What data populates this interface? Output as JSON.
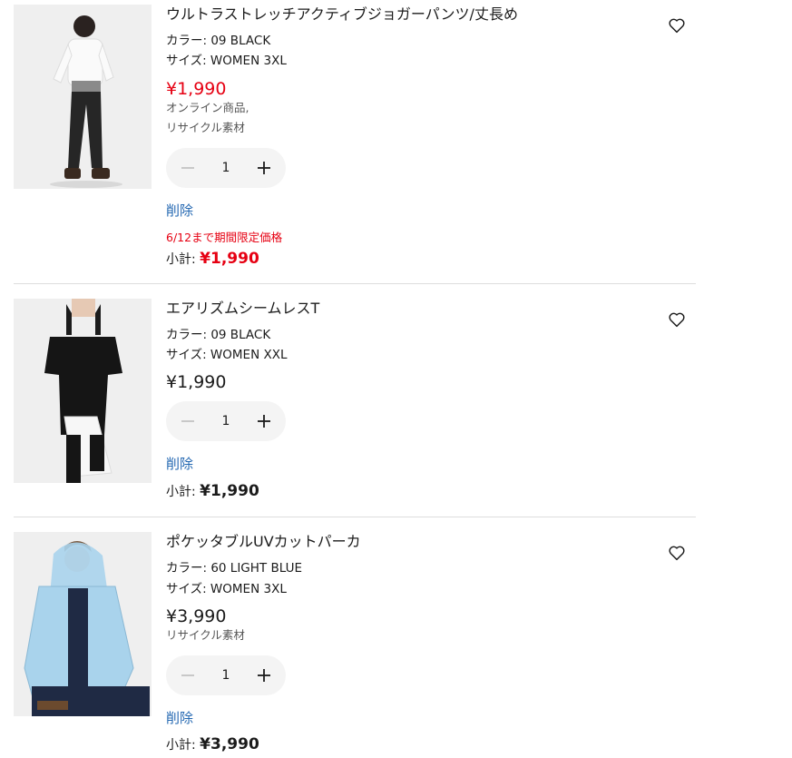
{
  "items": [
    {
      "name": "ウルトラストレッチアクティブジョガーパンツ/丈長め",
      "color_label": "カラー: 09 BLACK",
      "size_label": "サイズ: WOMEN 3XL",
      "price": "¥1,990",
      "price_color": "#e60012",
      "notes": [
        "オンライン商品,",
        "リサイクル素材"
      ],
      "quantity": "1",
      "delete_label": "削除",
      "promo": "6/12まで期間限定価格",
      "subtotal_label": "小計:",
      "subtotal_value": "¥1,990",
      "favorite_icon": "heart-outline-icon"
    },
    {
      "name": "エアリズムシームレスT",
      "color_label": "カラー: 09 BLACK",
      "size_label": "サイズ: WOMEN XXL",
      "price": "¥1,990",
      "quantity": "1",
      "delete_label": "削除",
      "subtotal_label": "小計:",
      "subtotal_value": "¥1,990",
      "favorite_icon": "heart-outline-icon"
    },
    {
      "name": "ポケッタブルUVカットパーカ",
      "color_label": "カラー: 60 LIGHT BLUE",
      "size_label": "サイズ: WOMEN 3XL",
      "price": "¥3,990",
      "notes": [
        "リサイクル素材"
      ],
      "quantity": "1",
      "delete_label": "削除",
      "subtotal_label": "小計:",
      "subtotal_value": "¥3,990",
      "favorite_icon": "heart-outline-icon"
    }
  ],
  "colors": {
    "sale_red": "#e60012",
    "link_blue": "#2468b2",
    "divider": "#dedede"
  }
}
